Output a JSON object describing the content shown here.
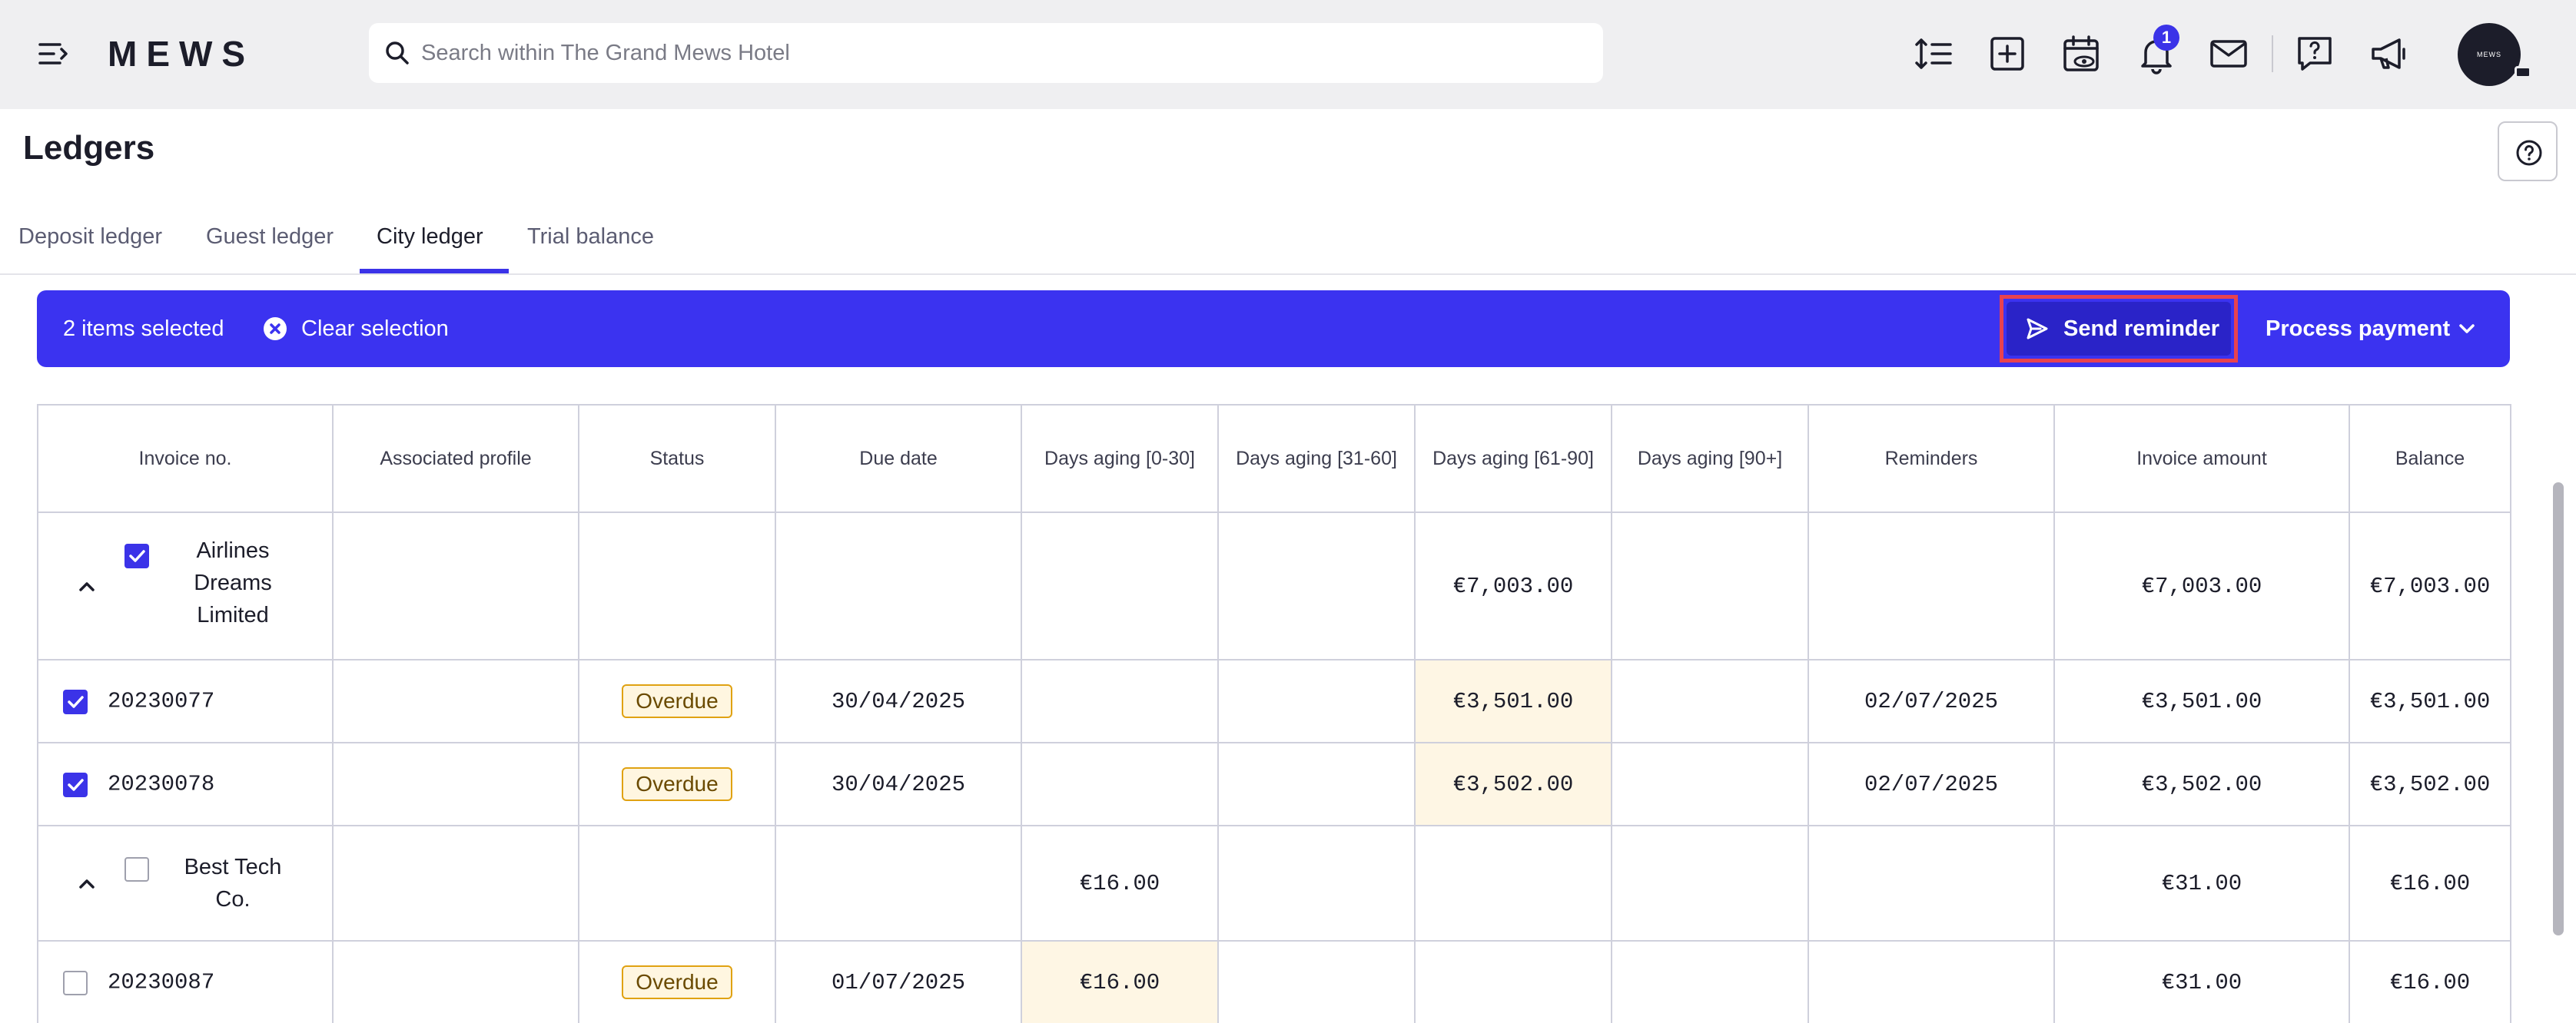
{
  "app": {
    "logo": "MEWS",
    "search_placeholder": "Search within The Grand Mews Hotel",
    "notification_count": "1",
    "avatar_text": "MEWS"
  },
  "page": {
    "title": "Ledgers",
    "tabs": [
      {
        "label": "Deposit ledger",
        "active": false
      },
      {
        "label": "Guest ledger",
        "active": false
      },
      {
        "label": "City ledger",
        "active": true
      },
      {
        "label": "Trial balance",
        "active": false
      }
    ]
  },
  "selection_bar": {
    "count_text": "2 items selected",
    "clear_label": "Clear selection",
    "send_reminder_label": "Send reminder",
    "process_payment_label": "Process payment"
  },
  "table": {
    "headers": [
      "Invoice no.",
      "Associated profile",
      "Status",
      "Due date",
      "Days aging [0-30]",
      "Days aging [31-60]",
      "Days aging [61-90]",
      "Days aging [90+]",
      "Reminders",
      "Invoice amount",
      "Balance"
    ],
    "groups": [
      {
        "name": "Airlines Dreams Limited",
        "checked": true,
        "aging_0_30": "",
        "aging_61_90": "€7,003.00",
        "invoice_amount": "€7,003.00",
        "balance": "€7,003.00",
        "invoices": [
          {
            "number": "20230077",
            "checked": true,
            "status": "Overdue",
            "due_date": "30/04/2025",
            "aging_61_90": "€3,501.00",
            "reminders": "02/07/2025",
            "invoice_amount": "€3,501.00",
            "balance": "€3,501.00"
          },
          {
            "number": "20230078",
            "checked": true,
            "status": "Overdue",
            "due_date": "30/04/2025",
            "aging_61_90": "€3,502.00",
            "reminders": "02/07/2025",
            "invoice_amount": "€3,502.00",
            "balance": "€3,502.00"
          }
        ]
      },
      {
        "name": "Best Tech Co.",
        "checked": false,
        "aging_0_30": "€16.00",
        "invoice_amount": "€31.00",
        "balance": "€16.00",
        "invoices": [
          {
            "number": "20230087",
            "checked": false,
            "status": "Overdue",
            "due_date": "01/07/2025",
            "aging_0_30": "€16.00",
            "invoice_amount": "€31.00",
            "balance": "€16.00"
          }
        ]
      }
    ]
  },
  "colors": {
    "accent": "#3b33e8",
    "selection_bar": "#3b33f0",
    "highlight_frame": "#e8424f",
    "aging_highlight": "#fef6e4",
    "overdue_border": "#e0a212"
  }
}
